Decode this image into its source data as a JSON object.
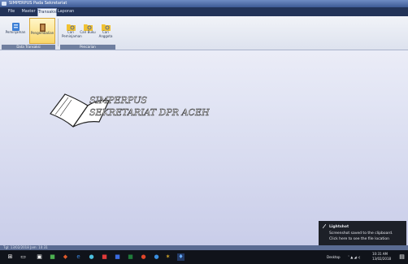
{
  "window": {
    "title": "SIMPERPUS Pada Sekretariat"
  },
  "menu": [
    {
      "label": "File"
    },
    {
      "label": "Master"
    },
    {
      "label": "Transaksi"
    },
    {
      "label": "Laporan"
    }
  ],
  "ribbon": {
    "groups": [
      {
        "label": "Data Transaksi",
        "buttons": [
          {
            "label": "Peminjaman"
          },
          {
            "label": "Pengembalian"
          }
        ]
      },
      {
        "label": "Pencarian",
        "buttons": [
          {
            "label": "Cari Peminjaman"
          },
          {
            "label": "Cari Buku"
          },
          {
            "label": "Cari Anggota"
          }
        ]
      }
    ]
  },
  "logo": {
    "line1": "SIMPERPUS",
    "line2": "SEKRETARIAT DPR ACEH"
  },
  "status": {
    "text": "Tgl: 13/02/2018  Jam: 10:31"
  },
  "notification": {
    "title": "Lightshot",
    "line1": "Screenshot saved to the clipboard.",
    "line2": "Click here to see the file location"
  },
  "taskbar": {
    "tray_label": "Desktop",
    "time": "10:31 AM",
    "date": "13/02/2018"
  },
  "colors": {
    "menubar": "#223358",
    "ribbon_highlight": "#f8d66a",
    "taskbar": "#10131a"
  }
}
